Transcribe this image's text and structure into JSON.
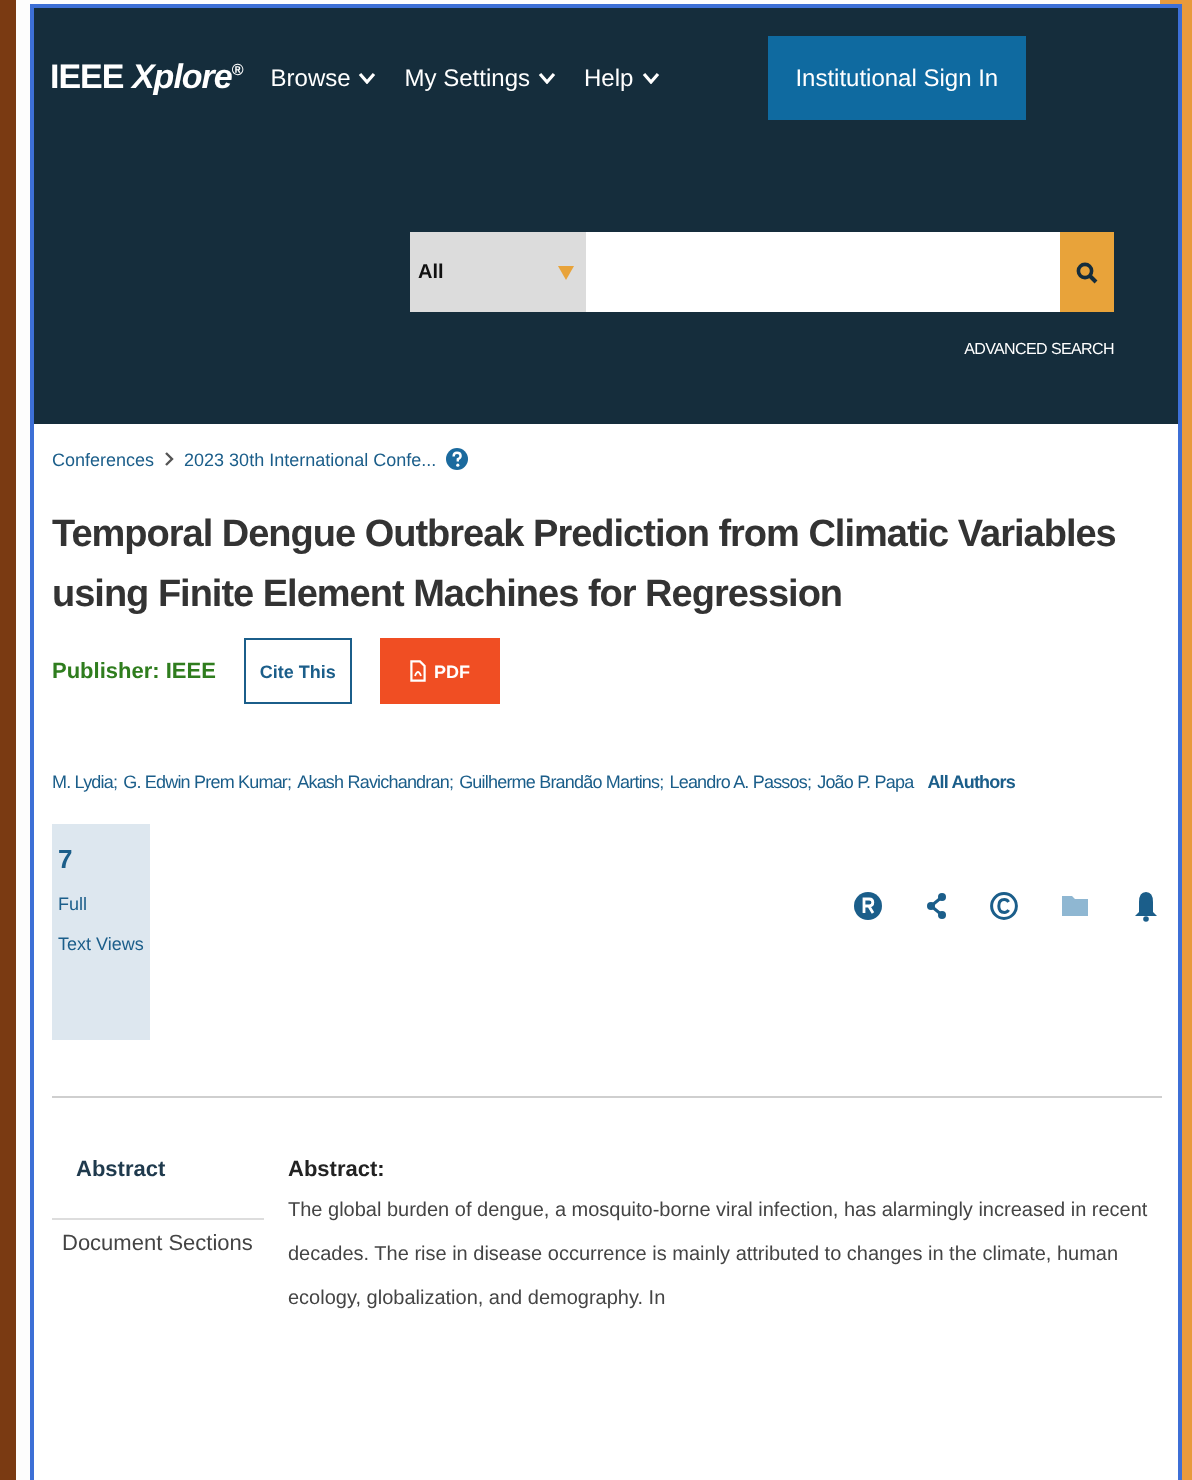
{
  "header": {
    "logo": "IEEE *Xplore*$^{®}$",
    "nav": [
      {
        "label": "Browse"
      },
      {
        "label": "My Settings"
      },
      {
        "label": "Help"
      }
    ],
    "sign_in": "Institutional Sign In",
    "search": {
      "scope": "All"
    },
    "advanced_search": "ADVANCED SEARCH"
  },
  "breadcrumbs": [
    "Conferences",
    "2023 30th International Confe..."
  ],
  "title": "Temporal Dengue Outbreak Prediction from Climatic Variables using Finite Element Machines for Regression",
  "publisher": {
    "label": "Publisher:",
    "name": "IEEE"
  },
  "buttons": [
    {
      "label": "Cite This",
      "kind": "outline"
    },
    {
      "label": "PDF",
      "kind": "pdf"
    }
  ],
  "authors": [
    "M. Lydia;",
    "G. Edwin Prem Kumar;",
    "Akash Ravichandran;",
    "Guilherme Brandão Martins;",
    "Leandro A. Passos;",
    "João P. Papa"
  ],
  "all_authors": "All Authors",
  "metrics": {
    "count": "7",
    "lines": [
      "Full",
      "Text Views"
    ]
  },
  "sidebar": [
    {
      "label": "Abstract",
      "selected": true
    },
    {
      "label": "Document Sections",
      "selected": false
    }
  ],
  "abstract": {
    "heading": "Abstract:",
    "text": "The global burden of dengue, a mosquito-borne viral infection, has alarmingly increased in recent decades. The rise in disease occurrence is mainly attributed to changes in the climate, human ecology, globalization, and demography. In"
  }
}
